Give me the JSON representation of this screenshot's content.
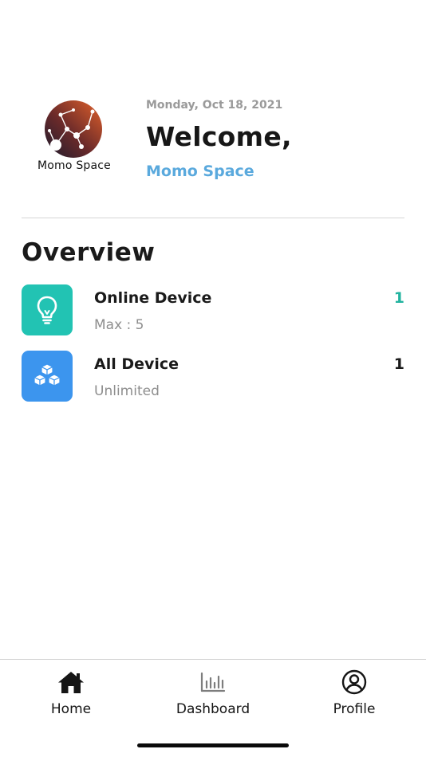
{
  "header": {
    "logo_text": "Momo Space",
    "date": "Monday, Oct 18, 2021",
    "welcome": "Welcome,",
    "user_name": "Momo Space"
  },
  "overview": {
    "title": "Overview",
    "devices": [
      {
        "title": "Online Device",
        "subtitle": "Max : 5",
        "count": "1",
        "icon": "lightbulb-icon",
        "color": "#22c3b3"
      },
      {
        "title": "All Device",
        "subtitle": "Unlimited",
        "count": "1",
        "icon": "boxes-icon",
        "color": "#3c95ee"
      }
    ]
  },
  "nav": {
    "items": [
      {
        "label": "Home",
        "icon": "home-icon"
      },
      {
        "label": "Dashboard",
        "icon": "bar-chart-icon"
      },
      {
        "label": "Profile",
        "icon": "user-circle-icon"
      }
    ]
  },
  "colors": {
    "accent_blue": "#5aa9dd",
    "teal": "#22c3b3",
    "blue": "#3c95ee"
  }
}
